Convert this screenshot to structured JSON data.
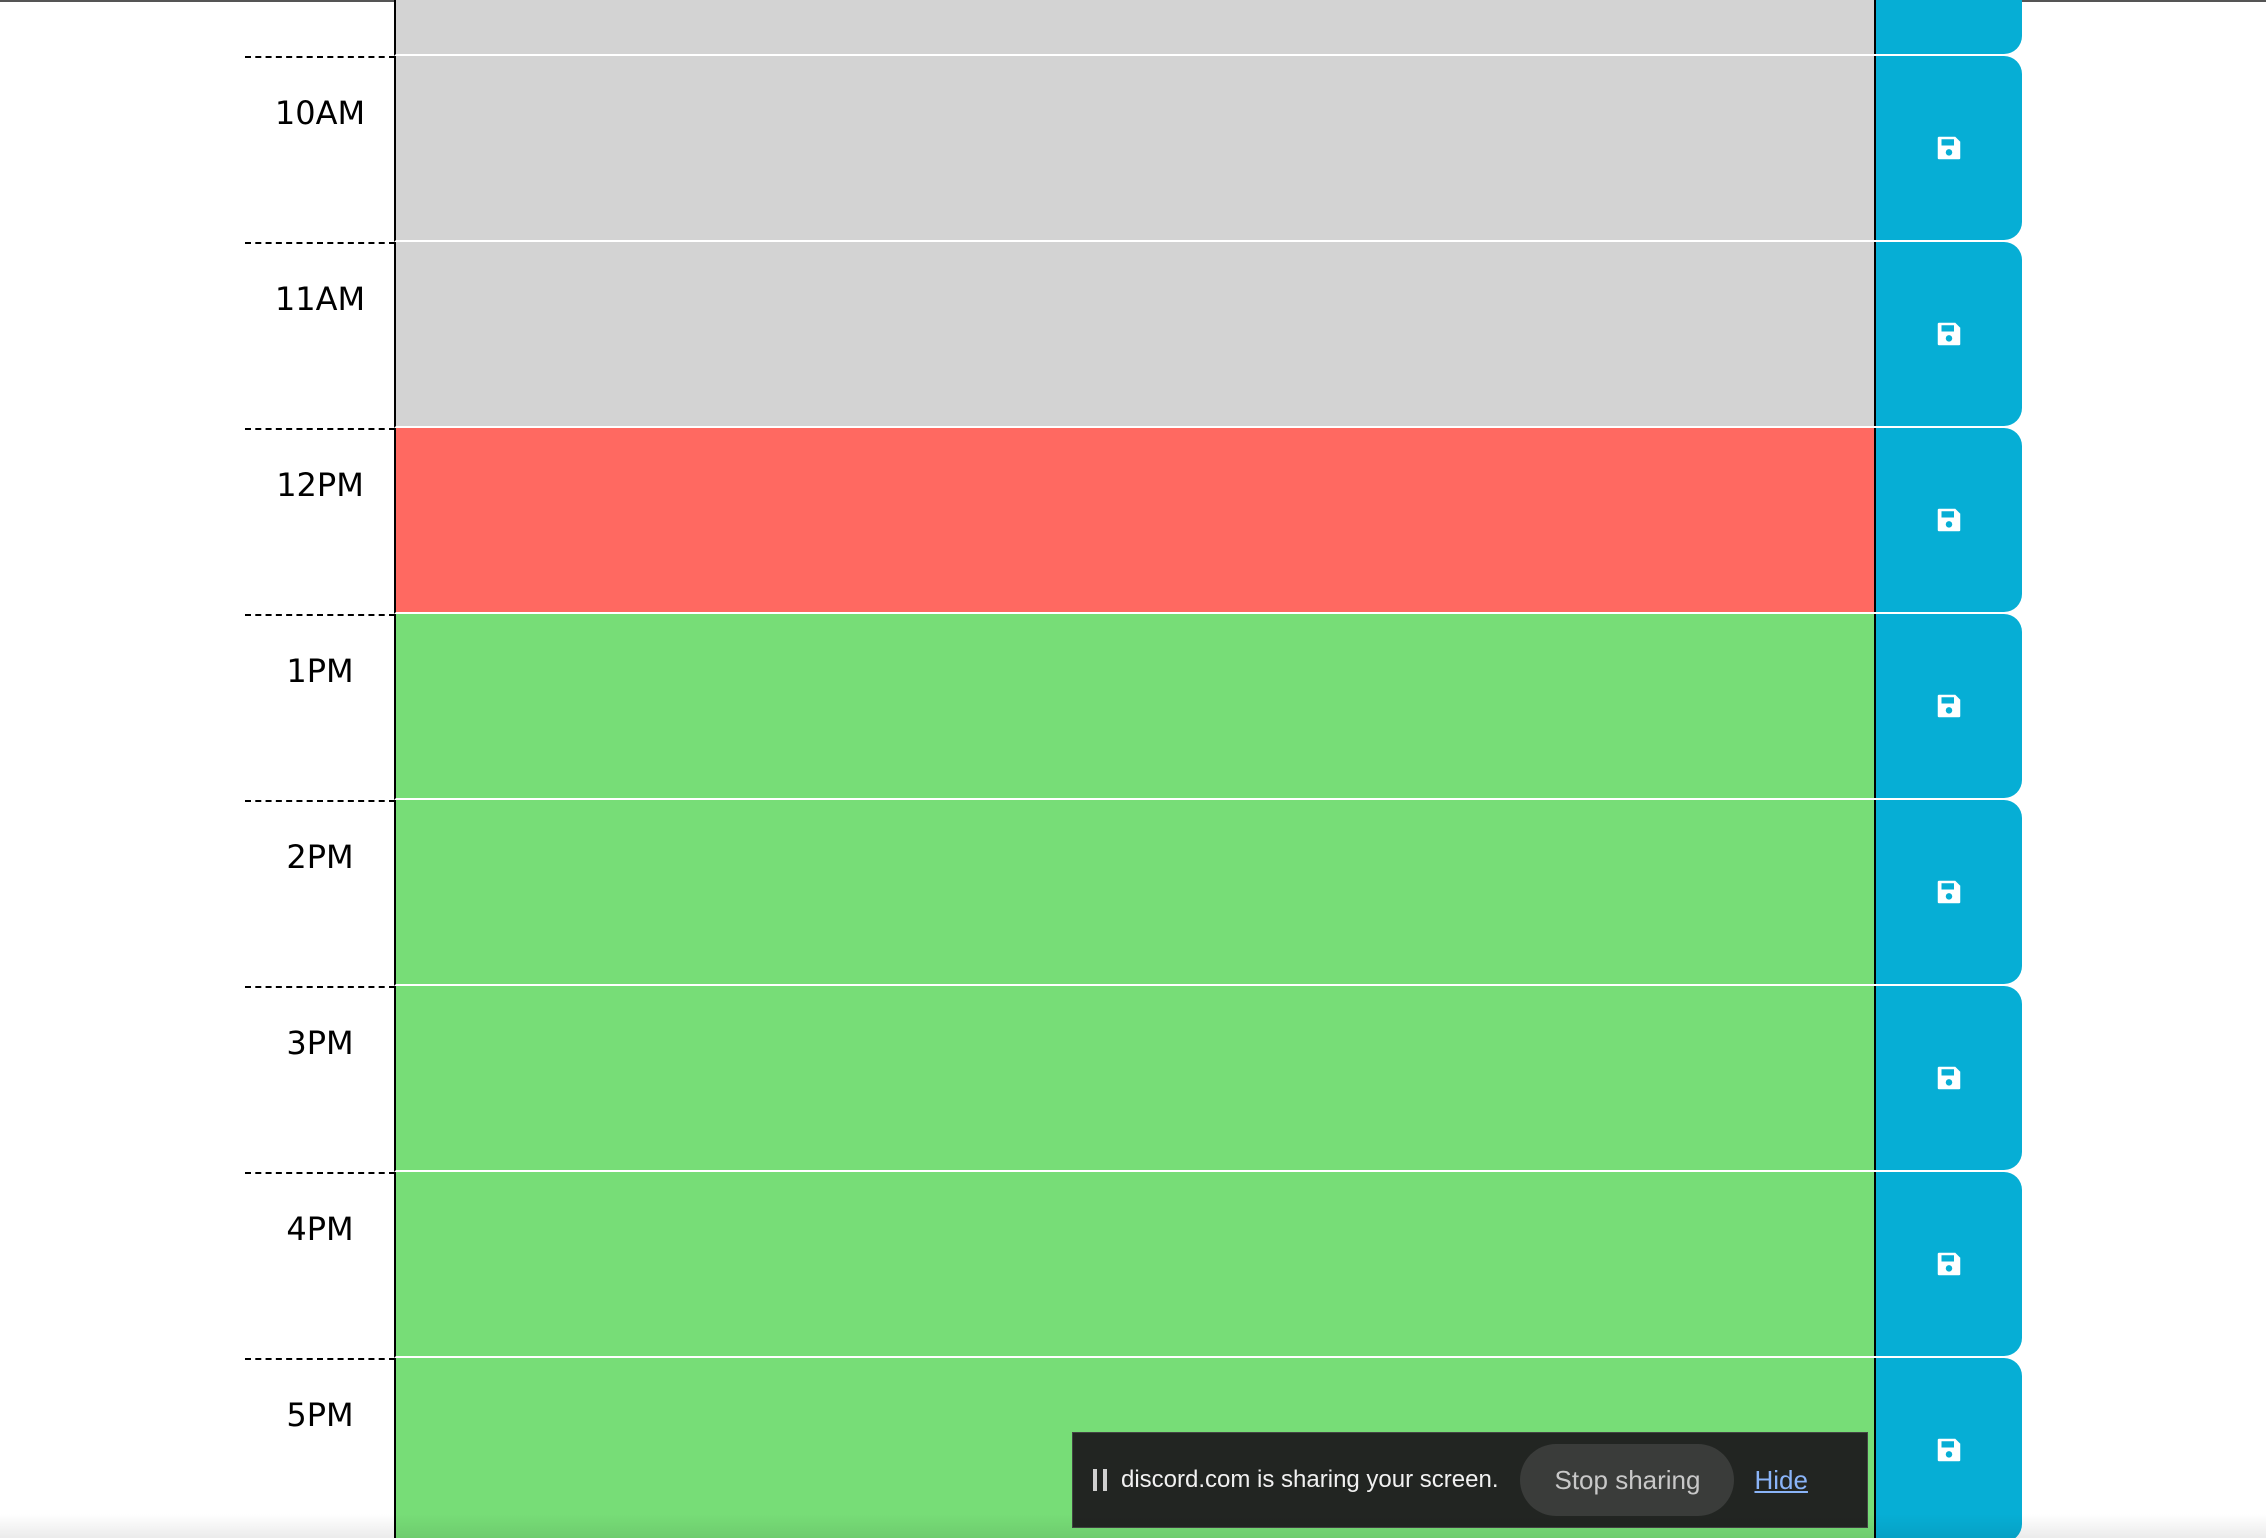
{
  "rows": [
    {
      "hour": "10AM",
      "state": "past"
    },
    {
      "hour": "11AM",
      "state": "past"
    },
    {
      "hour": "12PM",
      "state": "present"
    },
    {
      "hour": "1PM",
      "state": "future"
    },
    {
      "hour": "2PM",
      "state": "future"
    },
    {
      "hour": "3PM",
      "state": "future"
    },
    {
      "hour": "4PM",
      "state": "future"
    },
    {
      "hour": "5PM",
      "state": "future"
    }
  ],
  "colors": {
    "past": "#d3d3d3",
    "present": "#ff6961",
    "future": "#77dd77",
    "save_button": "#06aed5"
  },
  "save_icon": "floppy-disk-icon",
  "share_bar": {
    "message": "discord.com is sharing your screen.",
    "stop_label": "Stop sharing",
    "hide_label": "Hide"
  }
}
